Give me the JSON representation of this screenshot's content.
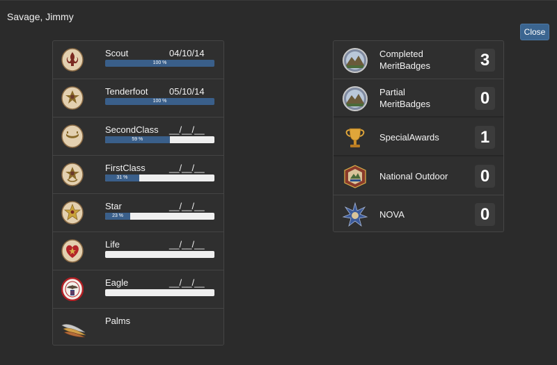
{
  "header": {
    "title": "Savage, Jimmy"
  },
  "actions": {
    "close_label": "Close"
  },
  "ranks": [
    {
      "name": "Scout",
      "date": "04/10/14",
      "percent": 100,
      "percent_label": "100 %",
      "icon": "scout-badge-icon"
    },
    {
      "name": "Tenderfoot",
      "date": "05/10/14",
      "percent": 100,
      "percent_label": "100 %",
      "icon": "tenderfoot-badge-icon"
    },
    {
      "name": "SecondClass",
      "date": "__/__/__",
      "percent": 59,
      "percent_label": "59 %",
      "icon": "second-class-badge-icon"
    },
    {
      "name": "FirstClass",
      "date": "__/__/__",
      "percent": 31,
      "percent_label": "31 %",
      "icon": "first-class-badge-icon"
    },
    {
      "name": "Star",
      "date": "__/__/__",
      "percent": 23,
      "percent_label": "23 %",
      "icon": "star-badge-icon"
    },
    {
      "name": "Life",
      "date": "__/__/__",
      "percent": 0,
      "percent_label": "",
      "icon": "life-badge-icon"
    },
    {
      "name": "Eagle",
      "date": "__/__/__",
      "percent": 0,
      "percent_label": "",
      "icon": "eagle-badge-icon"
    },
    {
      "name": "Palms",
      "icon": "palms-icon"
    }
  ],
  "awards": [
    {
      "label": "Completed MeritBadges",
      "count": "3",
      "icon": "merit-badge-icon"
    },
    {
      "label": "Partial MeritBadges",
      "count": "0",
      "icon": "merit-badge-icon"
    },
    {
      "label": "SpecialAwards",
      "count": "1",
      "icon": "trophy-icon"
    },
    {
      "label": "National Outdoor",
      "count": "0",
      "icon": "national-outdoor-badge-icon"
    },
    {
      "label": "NOVA",
      "count": "0",
      "icon": "nova-icon"
    }
  ],
  "colors": {
    "background": "#2b2b2b",
    "panel": "#2f2f2f",
    "accent": "#3b6590",
    "progress_fill": "#3a5f8a",
    "progress_track": "#efefef"
  }
}
